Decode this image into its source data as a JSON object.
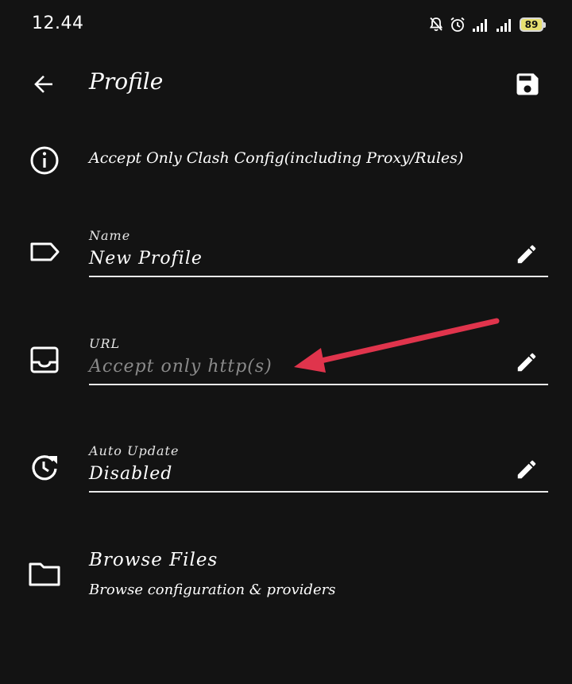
{
  "status_bar": {
    "time": "12.44",
    "battery": "89"
  },
  "toolbar": {
    "title": "Profile"
  },
  "info": {
    "text": "Accept Only Clash Config(including Proxy/Rules)"
  },
  "fields": {
    "name": {
      "label": "Name",
      "value": "New Profile"
    },
    "url": {
      "label": "URL",
      "placeholder": "Accept only http(s)"
    },
    "auto_update": {
      "label": "Auto Update",
      "value": "Disabled"
    }
  },
  "browse": {
    "title": "Browse Files",
    "subtitle": "Browse configuration & providers"
  },
  "colors": {
    "background": "#131313",
    "annotation_arrow": "#e0344c"
  }
}
